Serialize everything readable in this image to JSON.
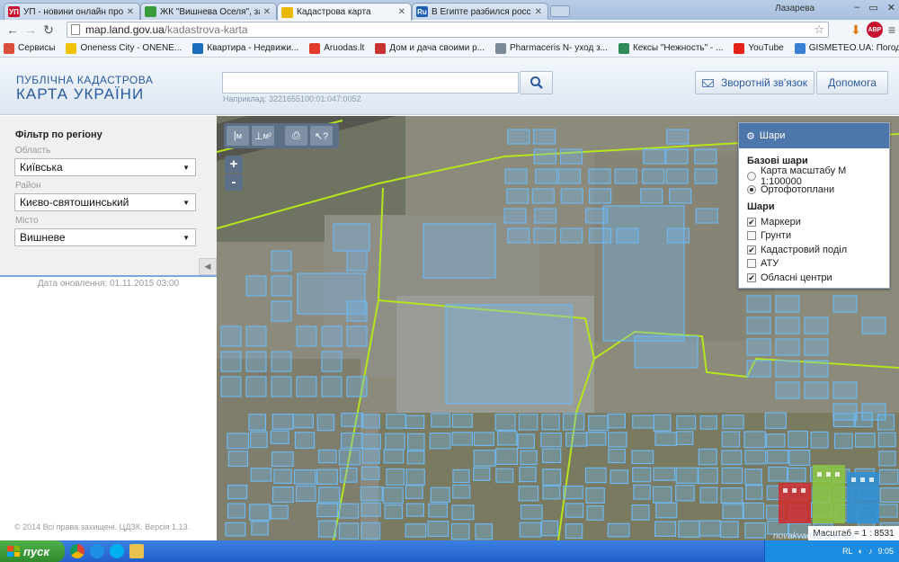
{
  "browser": {
    "tabs": [
      {
        "title": "УП - новини онлайн про Укр",
        "fav_text": "УП",
        "fav_color": "#c8102e"
      },
      {
        "title": "ЖК \"Вишнева Оселя\", заст",
        "fav_text": "",
        "fav_color": "#3a9b3a"
      },
      {
        "title": "Кадастрова карта",
        "fav_text": "",
        "fav_color": "#e8b900"
      },
      {
        "title": "В Египте разбился российс",
        "fav_text": "Ru",
        "fav_color": "#1f5fb0"
      }
    ],
    "profile_name": "Лазарева",
    "url_host": "map.land.gov.ua",
    "url_path": "/kadastrova-karta",
    "bookmarks": [
      {
        "label": "Сервисы",
        "color": "#d94d3a"
      },
      {
        "label": "Oneness City - ONENE...",
        "color": "#f0c200"
      },
      {
        "label": "Квартира - Недвижи...",
        "color": "#1a6ebd"
      },
      {
        "label": "Aruodas.lt",
        "color": "#e23a2a"
      },
      {
        "label": "Дом и дача своими р...",
        "color": "#c83232"
      },
      {
        "label": "Pharmaceris N- уход з...",
        "color": "#7a8a99"
      },
      {
        "label": "Кексы \"Нежность\" - ...",
        "color": "#2e8b57"
      },
      {
        "label": "YouTube",
        "color": "#e62117"
      },
      {
        "label": "GISMETEO.UA: Погод...",
        "color": "#3a7fd6"
      }
    ]
  },
  "header": {
    "logo_line1": "ПУБЛІЧНА КАДАСТРОВА",
    "logo_line2": "КАРТА УКРАЇНИ",
    "search_value": "",
    "search_hint": "Наприклад: 3221655100:01:047:0052",
    "feedback_label": "Зворотній зв'язок",
    "help_label": "Допомога"
  },
  "sidebar": {
    "filter_title": "Фільтр по регіону",
    "oblast_label": "Область",
    "oblast_value": "Київська",
    "rayon_label": "Район",
    "rayon_value": "Києво-святошинський",
    "city_label": "Місто",
    "city_value": "Вишневе",
    "update_date": "Дата оновлення: 01.11.2015 03:00",
    "copyright": "© 2014 Всі права захищені. ЦДЗК. Версія 1.13."
  },
  "map": {
    "tool_labels": [
      "м",
      "м²"
    ],
    "zoom_in": "+",
    "zoom_out": "-",
    "layers_title": "Шари",
    "base_layers_title": "Базові шари",
    "base_layers": [
      {
        "label": "Карта масштабу М 1:100000",
        "selected": false
      },
      {
        "label": "Ортофотоплани",
        "selected": true
      }
    ],
    "layers_group_title": "Шари",
    "layers": [
      {
        "label": "Маркери",
        "checked": true
      },
      {
        "label": "Грунти",
        "checked": false
      },
      {
        "label": "Кадастровий поділ",
        "checked": true
      },
      {
        "label": "АТУ",
        "checked": false
      },
      {
        "label": "Обласні центри",
        "checked": true
      }
    ],
    "scale_text": "Масштаб = 1 : 8531",
    "watermark_site": "novakvartira.com.ua",
    "parcel_color": "#6fb7ee",
    "boundary_color": "#b5e61d"
  },
  "taskbar": {
    "start_label": "пуск",
    "lang": "RL",
    "time": "9:05"
  }
}
